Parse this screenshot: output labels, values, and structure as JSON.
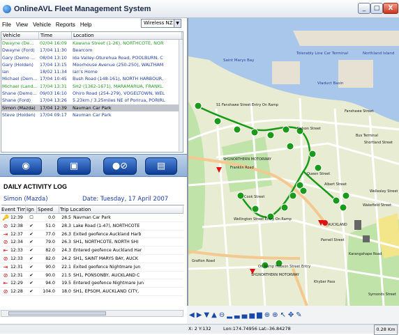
{
  "window": {
    "title": "OnlineAVL Fleet Management System",
    "min": "_",
    "max": "□",
    "close": "X"
  },
  "menu": {
    "file": "File",
    "view": "View",
    "vehicle": "Vehicle",
    "reports": "Reports",
    "help": "Help"
  },
  "region": {
    "value": "Wireless NZ"
  },
  "vehicles": {
    "headers": [
      "Vehicle",
      "Time",
      "Location"
    ],
    "rows": [
      {
        "vehicle": "Dwayne (De...",
        "time": "02/04 16:09",
        "location": "Kawana Street (1-26), NORTHCOTE, NOR",
        "color": "#2a9a2a"
      },
      {
        "vehicle": "Dwayne (Ford)",
        "time": "17/04 11:30",
        "location": "Bearcom",
        "color": "#1f3fa8"
      },
      {
        "vehicle": "Gary (Demo ...",
        "time": "08/04 13:10",
        "location": "Ida Valley-Oturehua Road, POOLBURN, C",
        "color": "#1f3fa8"
      },
      {
        "vehicle": "Gary (Holden)",
        "time": "17/04 13:15",
        "location": "Moorhouse Avenue (250-250), WALTHAM",
        "color": "#1f3fa8"
      },
      {
        "vehicle": "Ian",
        "time": "18/02 11:34",
        "location": "Ian's Home",
        "color": "#1f3fa8"
      },
      {
        "vehicle": "Michael (Dem...",
        "time": "17/04 10:45",
        "location": "Bush Road (148-161), NORTH HARBOUR,",
        "color": "#1f3fa8"
      },
      {
        "vehicle": "Michael (Land...",
        "time": "17/04 13:31",
        "location": "SH2 (1362-1671), MARAMARUA, FRANKL",
        "color": "#2a9a2a"
      },
      {
        "vehicle": "Shane (Demo...",
        "time": "09/03 16:10",
        "location": "Ohiro Road (254-279), VOGELTOWN, WEL",
        "color": "#1f3fa8"
      },
      {
        "vehicle": "Shane (Ford)",
        "time": "17/04 13:26",
        "location": "5.23km / 3.25miles NE of Porirua, PORIRL",
        "color": "#1f3fa8"
      },
      {
        "vehicle": "Simon (Mazda)",
        "time": "17/04 12:39",
        "location": "Navman Car Park",
        "color": "#000000",
        "selected": true
      },
      {
        "vehicle": "Steve (Holden)",
        "time": "17/04 09:17",
        "location": "Navman Car Park",
        "color": "#1f3fa8"
      }
    ]
  },
  "toolbar": {
    "buttons": [
      {
        "name": "globe-button",
        "icon": "◉"
      },
      {
        "name": "vehicles-button",
        "icon": "▣"
      },
      {
        "name": "alerts-button",
        "icon": "●⊘"
      },
      {
        "name": "reports-button",
        "icon": "▤"
      }
    ]
  },
  "log": {
    "title": "DAILY ACTIVITY LOG",
    "vehicle": "Simon (Mazda)",
    "date": "Date: Tuesday, 17 April 2007",
    "headers": {
      "event": "Event Time",
      "ign": "Ign",
      "speed": "Speed",
      "trip": "Trip Location"
    },
    "rows": [
      {
        "icon": "key-icon",
        "glyph": "🔑",
        "color": "#1a3fbf",
        "time": "12:39",
        "ign": "☐",
        "speed": "0.0",
        "trip": "28.5",
        "location": "Navman Car Park"
      },
      {
        "icon": "speed-icon",
        "glyph": "⊘",
        "color": "#d11",
        "time": "12:38",
        "ign": "✔",
        "speed": "51.0",
        "trip": "28.3",
        "location": "Lake Road (1-47), NORTHCOTE"
      },
      {
        "icon": "exit-icon",
        "glyph": "⇥",
        "color": "#d11",
        "time": "12:37",
        "ign": "✔",
        "speed": "77.0",
        "trip": "26.3",
        "location": "Exited geofence Auckland Harb"
      },
      {
        "icon": "speed-icon",
        "glyph": "⊘",
        "color": "#d11",
        "time": "12:34",
        "ign": "✔",
        "speed": "79.0",
        "trip": "26.3",
        "location": "SH1, NORTHCOTE, NORTH SHI"
      },
      {
        "icon": "enter-icon",
        "glyph": "⇤",
        "color": "#d11",
        "time": "12:33",
        "ign": "✔",
        "speed": "82.0",
        "trip": "24.3",
        "location": "Entered geofence Auckland Har"
      },
      {
        "icon": "speed-icon",
        "glyph": "⊘",
        "color": "#d11",
        "time": "12:33",
        "ign": "✔",
        "speed": "82.0",
        "trip": "24.2",
        "location": "SH1, SAINT MARYS BAY, AUCK"
      },
      {
        "icon": "exit-icon",
        "glyph": "⇥",
        "color": "#d11",
        "time": "12:31",
        "ign": "✔",
        "speed": "90.0",
        "trip": "22.1",
        "location": "Exited geofence Nightmare Jun"
      },
      {
        "icon": "speed-icon",
        "glyph": "⊘",
        "color": "#d11",
        "time": "12:31",
        "ign": "✔",
        "speed": "90.0",
        "trip": "21.5",
        "location": "SH1, PONSONBY, AUCKLAND C"
      },
      {
        "icon": "enter-icon",
        "glyph": "⇤",
        "color": "#d11",
        "time": "12:29",
        "ign": "✔",
        "speed": "94.0",
        "trip": "19.5",
        "location": "Entered geofence Nightmare Jun"
      },
      {
        "icon": "speed-icon",
        "glyph": "⊘",
        "color": "#d11",
        "time": "12:28",
        "ign": "✔",
        "speed": "104.0",
        "trip": "18.0",
        "location": "SH1, EPSOM, AUCKLAND CITY,"
      }
    ]
  },
  "map": {
    "labels": {
      "tole": "Tolerably Line Car Terminal",
      "northland": "Northland Island",
      "saint_mary": "Saint Marys Bay",
      "viaduct": "Viaduct Basin",
      "panshawe_entry": "S1 Fanshawe Street Entry On Ramp",
      "fanshawe": "Fanshawe Street",
      "bus_terminal": "Bus Terminal",
      "shortland": "Shortland Street",
      "nelson": "Nelson Street",
      "shortnorthern": "SH1NORTHERN MOTORWAY",
      "franklin": "Franklin Road",
      "cook": "Cook Street",
      "wellington": "Wellington Street Entry On Ramp",
      "auckland": "AUCKLAND",
      "ronald": "On Ramp Hobson Street Entry",
      "symonds": "Symonds Street",
      "wakefield": "Wakefield Street",
      "kirbly": "Karangahape Road",
      "northern_motorway2": "SH1NORTHERN MOTORWAY",
      "grafton": "Grafton Road",
      "khyber": "Khyber Pass",
      "wellesley": "Wellesley Street",
      "queen": "Queen Street",
      "albert": "Albert Street",
      "parnell": "Parnell Street"
    }
  },
  "maptools": [
    "◀",
    "▶",
    "▼",
    "▲",
    "⊖",
    "▂",
    "▃",
    "▄",
    "▅",
    "▆",
    "⊕",
    "⊕",
    "↖",
    "✥",
    "✎"
  ],
  "status": {
    "xy": "X: 2 Y:132",
    "lonlat": "Lon:174.74956 Lat:-36.84278",
    "scale": "0.28 Km"
  }
}
